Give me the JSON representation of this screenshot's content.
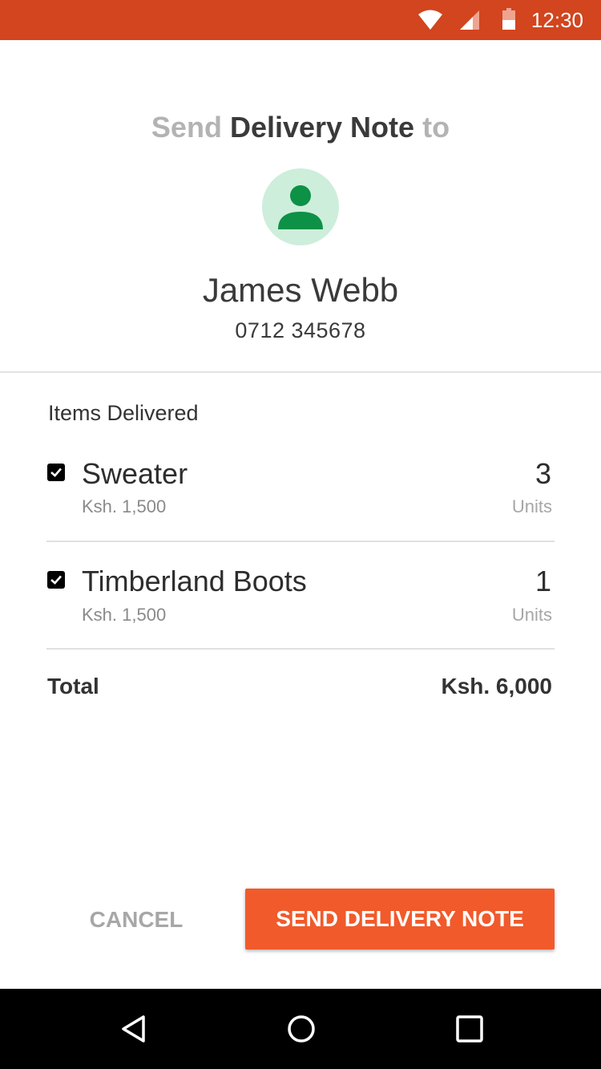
{
  "status_bar": {
    "time": "12:30",
    "icons": [
      "wifi-icon",
      "cell-signal-icon",
      "battery-icon"
    ],
    "color": "#d2451e"
  },
  "header": {
    "prefix": "Send",
    "title": "Delivery Note",
    "suffix": "to"
  },
  "contact": {
    "avatar_icon": "person-icon",
    "name": "James Webb",
    "phone": "0712 345678"
  },
  "items_section": {
    "label": "Items Delivered",
    "items": [
      {
        "checked": true,
        "name": "Sweater",
        "price": "Ksh. 1,500",
        "quantity": "3",
        "unit": "Units"
      },
      {
        "checked": true,
        "name": "Timberland Boots",
        "price": "Ksh. 1,500",
        "quantity": "1",
        "unit": "Units"
      }
    ]
  },
  "total": {
    "label": "Total",
    "value": "Ksh. 6,000"
  },
  "actions": {
    "cancel_label": "CANCEL",
    "send_label": "SEND DELIVERY NOTE",
    "accent_color": "#f15a2b"
  },
  "nav_bar": {
    "icons": [
      "back-icon",
      "home-icon",
      "recents-icon"
    ]
  }
}
